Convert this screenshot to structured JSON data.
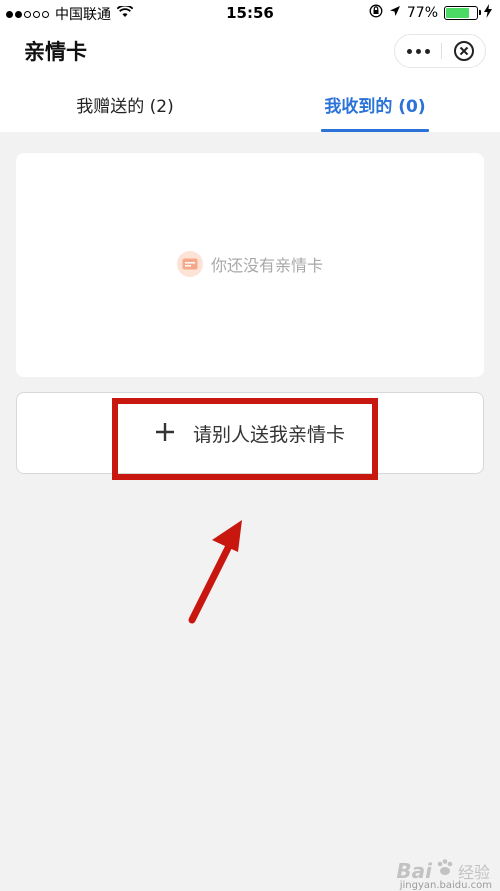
{
  "status_bar": {
    "carrier": "中国联通",
    "time": "15:56",
    "battery_percent": "77%",
    "battery_level": 0.77,
    "signal_bars_filled": 2,
    "signal_bars_total": 5,
    "icons": [
      "wifi-icon",
      "orientation-lock-icon",
      "location-arrow-icon",
      "battery-icon",
      "charging-bolt-icon"
    ]
  },
  "header": {
    "title": "亲情卡",
    "more_icon": "more-dots-icon",
    "close_icon": "close-circle-icon"
  },
  "tabs": [
    {
      "label": "我赠送的 (2)",
      "active": false
    },
    {
      "label": "我收到的 (0)",
      "active": true
    }
  ],
  "empty_state": {
    "text": "你还没有亲情卡",
    "icon": "card-icon"
  },
  "request_button": {
    "label": "请别人送我亲情卡",
    "icon": "plus-icon"
  },
  "colors": {
    "accent": "#2b73d8",
    "background": "#f2f2f2",
    "annotation": "#c8170f",
    "empty_icon_bg": "#fde3d6"
  },
  "watermark": {
    "brand": "Bai",
    "brand_suffix": "经验",
    "url": "jingyan.baidu.com"
  }
}
